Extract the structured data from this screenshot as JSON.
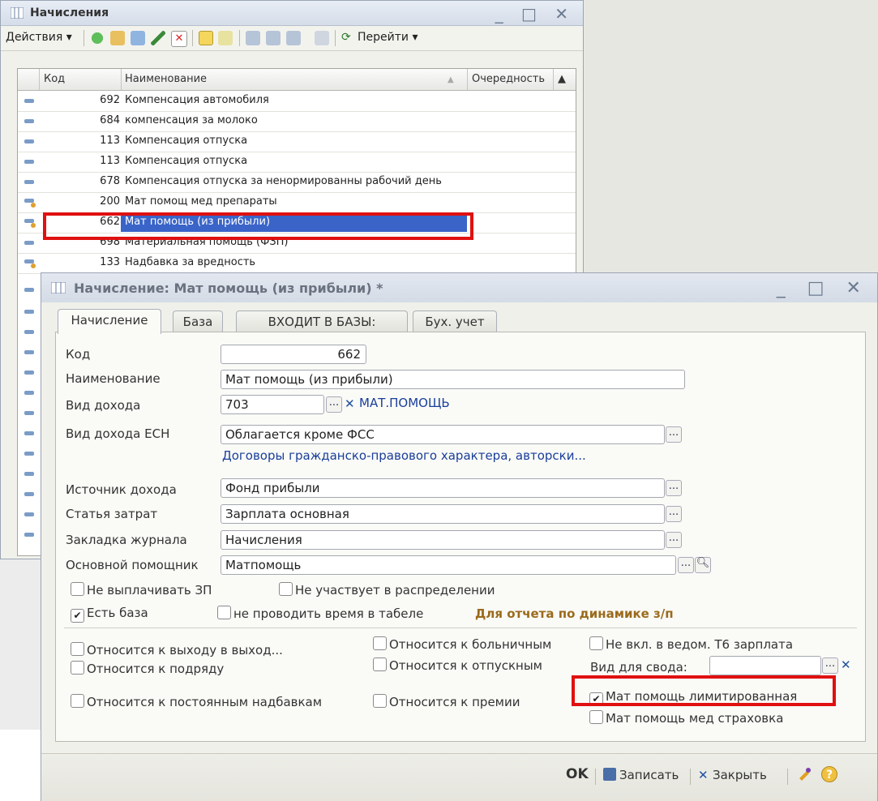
{
  "list_window": {
    "title": "Начисления",
    "toolbar": {
      "actions_label": "Действия ▾",
      "goto_label": "Перейти ▾"
    },
    "columns": {
      "code": "Код",
      "name": "Наименование",
      "order": "Очередность"
    },
    "rows": [
      {
        "code": "692",
        "name": "Компенсация автомобиля"
      },
      {
        "code": "684",
        "name": "компенсация за молоко"
      },
      {
        "code": "113",
        "name": "Компенсация отпуска"
      },
      {
        "code": "113",
        "name": "Компенсация отпуска"
      },
      {
        "code": "678",
        "name": "Компенсация отпуска за ненормированны рабочий день"
      },
      {
        "code": "200",
        "name": "Мат помощ мед препараты"
      },
      {
        "code": "662",
        "name": "Мат помощь (из прибыли)"
      },
      {
        "code": "698",
        "name": "Материальная помощь (ФЗП)"
      },
      {
        "code": "133",
        "name": "Надбавка за вредность"
      }
    ]
  },
  "form": {
    "title": "Начисление: Мат помощь (из прибыли) *",
    "tabs": [
      "Начисление",
      "База",
      "ВХОДИТ В БАЗЫ:",
      "Бух. учет"
    ],
    "labels": {
      "code": "Код",
      "name": "Наименование",
      "income_type": "Вид дохода",
      "esn_type": "Вид дохода ЕСН",
      "income_source": "Источник дохода",
      "cost_item": "Статья затрат",
      "journal_tab": "Закладка журнала",
      "main_helper": "Основной помощник",
      "summary_type": "Вид для свода:"
    },
    "values": {
      "code": "662",
      "name": "Мат помощь (из прибыли)",
      "income_type": "703",
      "income_type_desc": "МАТ.ПОМОЩЬ",
      "esn_type": "Облагается кроме ФСС",
      "esn_link": "Договоры гражданско-правового характера, авторски...",
      "income_source": "Фонд прибыли",
      "cost_item": "Зарплата основная",
      "journal_tab": "Начисления",
      "main_helper": "Матпомощь",
      "summary_type": ""
    },
    "checkboxes": {
      "no_pay": {
        "label": "Не выплачивать ЗП",
        "checked": false
      },
      "no_distrib": {
        "label": "Не участвует в распределении",
        "checked": false
      },
      "has_base": {
        "label": "Есть база",
        "checked": true
      },
      "no_time": {
        "label": "не проводить время в табеле",
        "checked": false
      },
      "weekend": {
        "label": "Относится к выходу в выход...",
        "checked": false
      },
      "sick": {
        "label": "Относится к больничным",
        "checked": false
      },
      "not_t6": {
        "label": "Не вкл. в ведом. Т6 зарплата",
        "checked": false
      },
      "contract": {
        "label": "Относится к подряду",
        "checked": false
      },
      "vacation": {
        "label": "Относится к отпускным",
        "checked": false
      },
      "permanent": {
        "label": "Относится к постоянным надбавкам",
        "checked": false
      },
      "bonus": {
        "label": "Относится к премии",
        "checked": false
      },
      "limited": {
        "label": "Мат помощь лимитированная",
        "checked": true
      },
      "insurance": {
        "label": "Мат помощь мед страховка",
        "checked": false
      }
    },
    "dynamics_note": "Для отчета по динамике з/п",
    "bottom": {
      "ok": "OK",
      "save": "Записать",
      "close": "Закрыть"
    }
  }
}
